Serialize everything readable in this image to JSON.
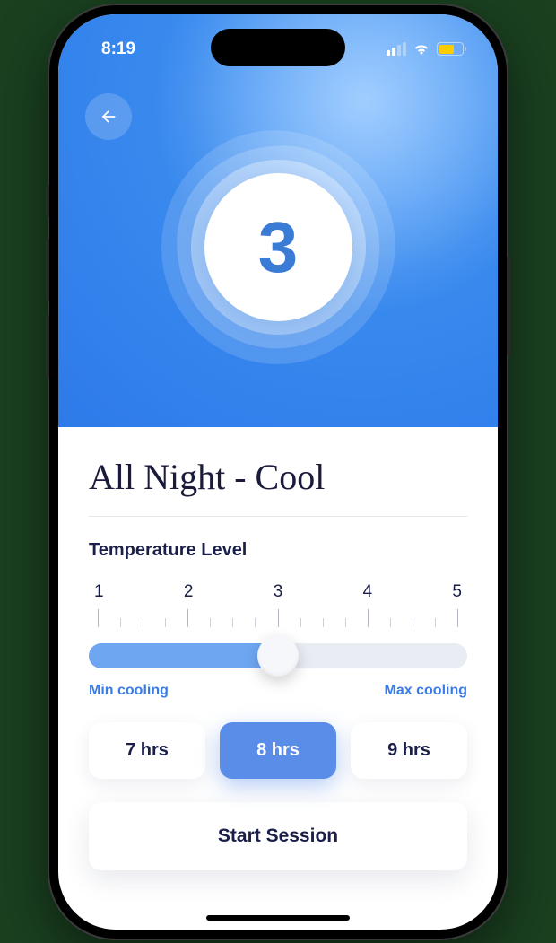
{
  "status": {
    "time": "8:19"
  },
  "hero": {
    "level_display": "3"
  },
  "main": {
    "title": "All Night - Cool",
    "section_label": "Temperature Level",
    "slider": {
      "ticks": [
        "1",
        "2",
        "3",
        "4",
        "5"
      ],
      "min_label": "Min cooling",
      "max_label": "Max cooling",
      "value": 3,
      "min": 1,
      "max": 5
    },
    "durations": [
      {
        "label": "7 hrs",
        "selected": false
      },
      {
        "label": "8 hrs",
        "selected": true
      },
      {
        "label": "9 hrs",
        "selected": false
      }
    ],
    "start_label": "Start Session"
  }
}
